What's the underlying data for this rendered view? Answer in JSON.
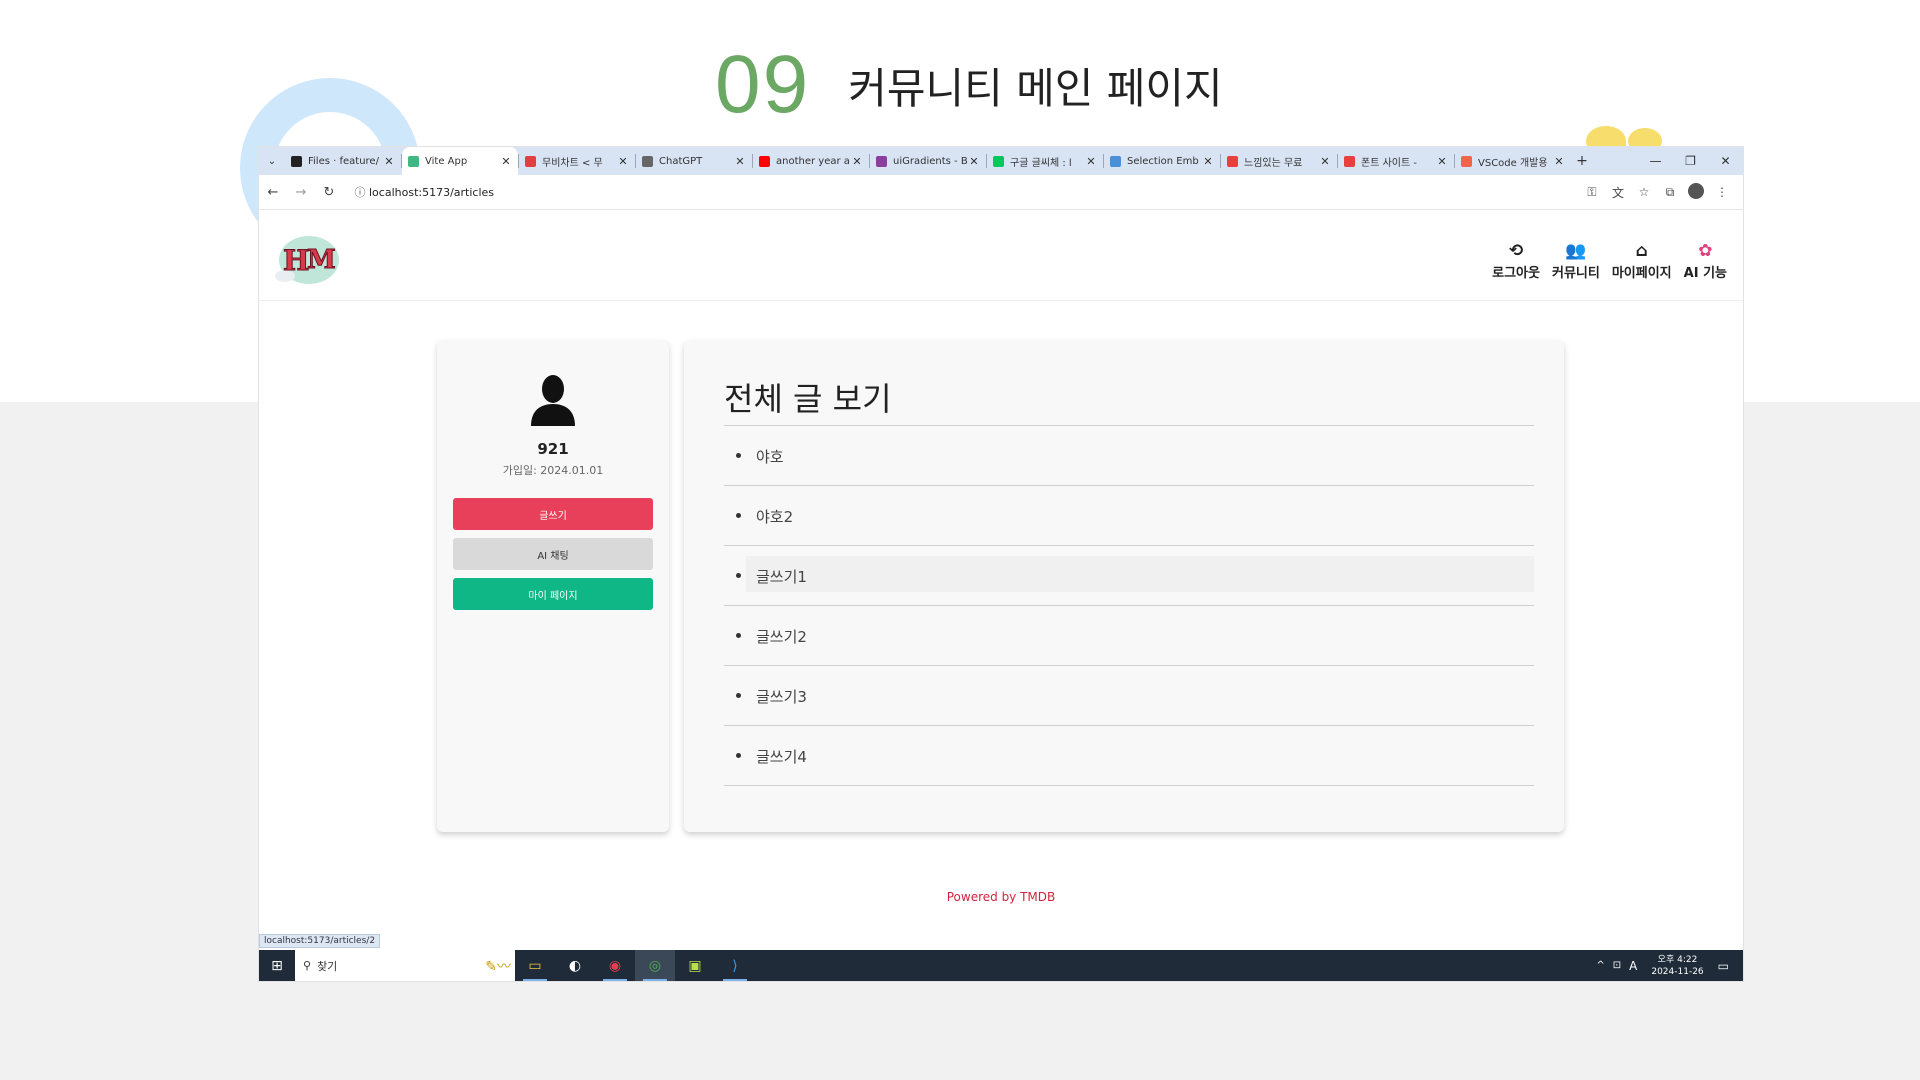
{
  "slide": {
    "number": "09",
    "title": "커뮤니티 메인 페이지"
  },
  "browser": {
    "tabs": [
      {
        "label": "Files · feature/",
        "icon": "gitlab-icon",
        "color": "#222222"
      },
      {
        "label": "Vite App",
        "icon": "vue-icon",
        "color": "#41b883"
      },
      {
        "label": "무비차트 < 무",
        "icon": "cgv-icon",
        "color": "#e04040"
      },
      {
        "label": "ChatGPT",
        "icon": "chatgpt-icon",
        "color": "#666666"
      },
      {
        "label": "another year a",
        "icon": "youtube-icon",
        "color": "#ff0000"
      },
      {
        "label": "uiGradients - B",
        "icon": "uigradients-icon",
        "color": "#8a3f9e"
      },
      {
        "label": "구글 글씨체 : l",
        "icon": "naver-icon",
        "color": "#03c75a"
      },
      {
        "label": "Selection Emb",
        "icon": "slack-icon",
        "color": "#4a90d9"
      },
      {
        "label": "느낌있는 무료",
        "icon": "fonts-icon",
        "color": "#e8403c"
      },
      {
        "label": "폰트 사이트 -",
        "icon": "fonts2-icon",
        "color": "#e8403c"
      },
      {
        "label": "VSCode 개발용",
        "icon": "vscode-blog-icon",
        "color": "#f0654a"
      }
    ],
    "url": "localhost:5173/articles",
    "status_url": "localhost:5173/articles/2"
  },
  "header": {
    "nav": [
      {
        "label": "로그아웃",
        "icon": "logout-icon"
      },
      {
        "label": "커뮤니티",
        "icon": "community-icon"
      },
      {
        "label": "마이페이지",
        "icon": "home-icon"
      },
      {
        "label": "AI 기능",
        "icon": "ai-icon"
      }
    ]
  },
  "profile": {
    "name": "921",
    "joined": "가입일: 2024.01.01",
    "buttons": {
      "write": "글쓰기",
      "ai_chat": "AI 채팅",
      "my_page": "마이 페이지"
    },
    "colors": {
      "write": "#e8405a",
      "ai_chat": "#d9d9d9",
      "my_page": "#0fb686"
    }
  },
  "articles": {
    "title": "전체 글 보기",
    "items": [
      "야호",
      "야호2",
      "글쓰기1",
      "글쓰기2",
      "글쓰기3",
      "글쓰기4"
    ]
  },
  "footer": {
    "powered": "Powered by TMDB"
  },
  "taskbar": {
    "search_placeholder": "찾기",
    "time": "오후 4:22",
    "date": "2024-11-26",
    "ime": "A"
  }
}
